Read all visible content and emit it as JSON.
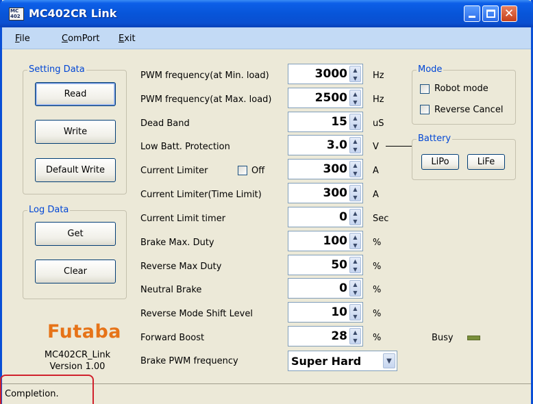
{
  "window": {
    "icon_text": "MC 402",
    "title": "MC402CR Link"
  },
  "menu": {
    "items": [
      "File",
      "ComPort",
      "Exit"
    ]
  },
  "setting_data": {
    "label": "Setting Data",
    "read": "Read",
    "write": "Write",
    "default_write": "Default Write"
  },
  "log_data": {
    "label": "Log Data",
    "get": "Get",
    "clear": "Clear"
  },
  "brand": {
    "logo": "Futaba",
    "app_name": "MC402CR_Link",
    "version": "Version 1.00"
  },
  "params": [
    {
      "label": "PWM frequency(at Min. load)",
      "value": "3000",
      "unit": "Hz"
    },
    {
      "label": "PWM frequency(at Max. load)",
      "value": "2500",
      "unit": "Hz"
    },
    {
      "label": "Dead Band",
      "value": "15",
      "unit": "uS"
    },
    {
      "label": "Low Batt. Protection",
      "value": "3.0",
      "unit": "V"
    },
    {
      "label": "Current Limiter",
      "value": "300",
      "unit": "A"
    },
    {
      "label": "Current Limiter(Time Limit)",
      "value": "300",
      "unit": "A"
    },
    {
      "label": "Current Limit timer",
      "value": "0",
      "unit": "Sec"
    },
    {
      "label": "Brake Max. Duty",
      "value": "100",
      "unit": "%"
    },
    {
      "label": "Reverse Max Duty",
      "value": "50",
      "unit": "%"
    },
    {
      "label": "Neutral Brake",
      "value": "0",
      "unit": "%"
    },
    {
      "label": "Reverse Mode Shift Level",
      "value": "10",
      "unit": "%"
    },
    {
      "label": "Forward Boost",
      "value": "28",
      "unit": "%"
    }
  ],
  "current_limiter_off": {
    "label": "Off",
    "checked": false
  },
  "brake_pwm": {
    "label": "Brake PWM frequency",
    "selected": "Super Hard"
  },
  "mode": {
    "label": "Mode",
    "robot_mode": "Robot mode",
    "robot_mode_checked": false,
    "reverse_cancel": "Reverse Cancel",
    "reverse_cancel_checked": false
  },
  "battery": {
    "label": "Battery",
    "lipo": "LiPo",
    "life": "LiFe"
  },
  "busy": {
    "label": "Busy",
    "led_color": "#7a8f3a"
  },
  "status": {
    "text": "Completion."
  },
  "colors": {
    "titlebar": "#0755d9",
    "menubar": "#c3daf5",
    "group_label": "#0046d5",
    "logo": "#e67318",
    "highlight": "#d0202c"
  }
}
